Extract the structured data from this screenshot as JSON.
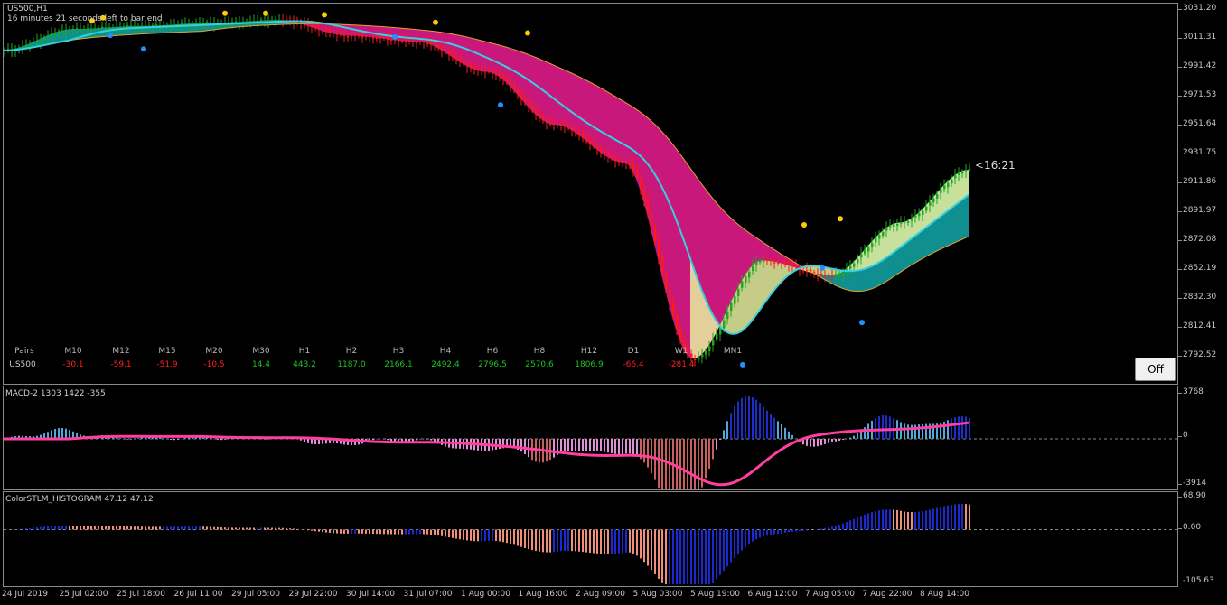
{
  "main": {
    "symbol_title": "US500,H1",
    "bar_info": "16 minutes 21 seconds left to bar end",
    "countdown": "<16:21",
    "price_ticks": [
      "3031.20",
      "3011.31",
      "2991.42",
      "2971.53",
      "2951.64",
      "2931.75",
      "2911.86",
      "2891.97",
      "2872.08",
      "2852.19",
      "2832.30",
      "2812.41",
      "2792.52"
    ],
    "off_button": "Off",
    "tf_table": {
      "pair_header": "Pairs",
      "pair": "US500",
      "columns": [
        {
          "label": "M10",
          "value": "-30.1",
          "sign": "neg"
        },
        {
          "label": "M12",
          "value": "-59.1",
          "sign": "neg"
        },
        {
          "label": "M15",
          "value": "-51.9",
          "sign": "neg"
        },
        {
          "label": "M20",
          "value": "-10.5",
          "sign": "neg"
        },
        {
          "label": "M30",
          "value": "14.4",
          "sign": "pos"
        },
        {
          "label": "H1",
          "value": "443.2",
          "sign": "pos"
        },
        {
          "label": "H2",
          "value": "1187.0",
          "sign": "pos"
        },
        {
          "label": "H3",
          "value": "2166.1",
          "sign": "pos"
        },
        {
          "label": "H4",
          "value": "2492.4",
          "sign": "pos"
        },
        {
          "label": "H6",
          "value": "2796.5",
          "sign": "pos"
        },
        {
          "label": "H8",
          "value": "2570.6",
          "sign": "pos"
        },
        {
          "label": "H12",
          "value": "1806.9",
          "sign": "pos"
        },
        {
          "label": "D1",
          "value": "-66.4",
          "sign": "neg"
        },
        {
          "label": "W1",
          "value": "-281.4",
          "sign": "neg"
        },
        {
          "label": "MN1",
          "value": "",
          "sign": "pos"
        }
      ]
    }
  },
  "macd": {
    "title": "MACD-2 1303 1422 -355",
    "ticks": [
      "3768",
      "0",
      "-3914"
    ],
    "ylim": [
      -3914,
      3768
    ]
  },
  "stlm": {
    "title": "ColorSTLM_HISTOGRAM 47.12 47.12",
    "ticks": [
      "68.90",
      "0.00",
      "-105.63"
    ],
    "ylim": [
      -105.63,
      68.9
    ]
  },
  "dates": [
    "24 Jul 2019",
    "25 Jul 02:00",
    "25 Jul 18:00",
    "26 Jul 11:00",
    "29 Jul 05:00",
    "29 Jul 22:00",
    "30 Jul 14:00",
    "31 Jul 07:00",
    "1 Aug 00:00",
    "1 Aug 16:00",
    "2 Aug 09:00",
    "5 Aug 03:00",
    "5 Aug 19:00",
    "6 Aug 12:00",
    "7 Aug 05:00",
    "7 Aug 22:00",
    "8 Aug 14:00"
  ],
  "colors": {
    "bull": "#1fa81f",
    "bear": "#ff1a1a",
    "cloud_up": "#0f8f8f",
    "cloud_down": "#c8187c",
    "ma_fast": "#36d0e0",
    "signal_dot_up": "#ffcc00",
    "signal_dot_down": "#1e90ff",
    "pos": "#22c222",
    "neg": "#ff2020"
  },
  "chart_data": {
    "type": "line",
    "ylim": [
      2784.0,
      3035.0
    ],
    "x": [
      "24 Jul",
      "25 Jul",
      "26 Jul",
      "29 Jul",
      "30 Jul",
      "31 Jul",
      "1 Aug",
      "1 Aug",
      "2 Aug",
      "5 Aug",
      "5 Aug",
      "6 Aug",
      "7 Aug",
      "7 Aug",
      "8 Aug"
    ],
    "series": [
      {
        "values": [
          3004,
          3018,
          3020,
          3022,
          3024,
          3014,
          3010,
          2990,
          2955,
          2930,
          2800,
          2865,
          2855,
          2890,
          2925
        ]
      }
    ]
  }
}
